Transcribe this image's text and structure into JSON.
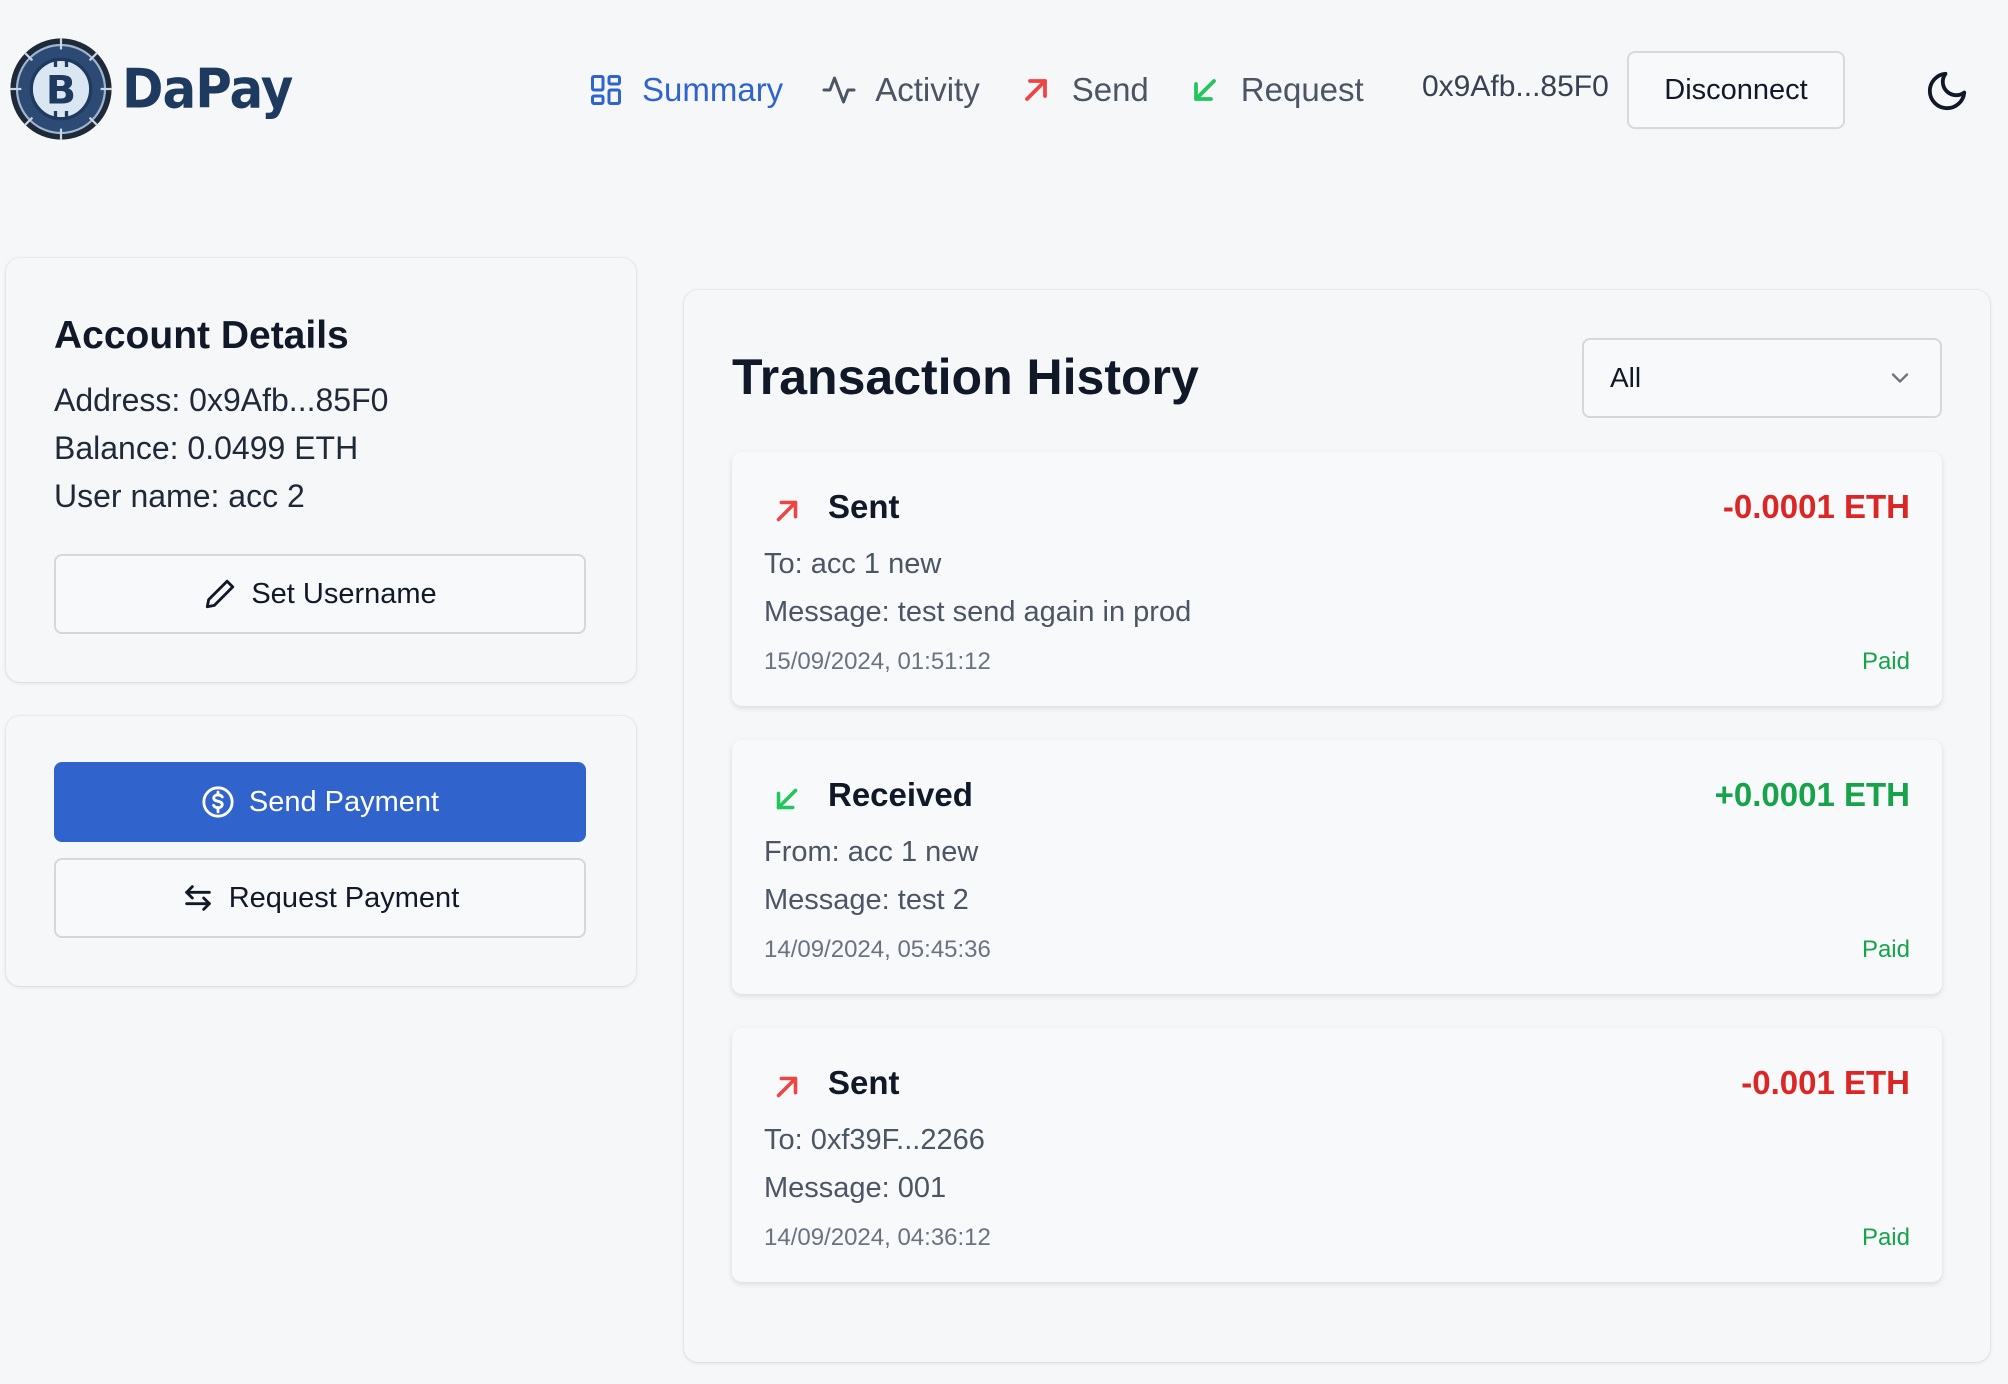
{
  "brand": {
    "name": "DaPay",
    "logo_icon": "bitcoin-gear-logo"
  },
  "colors": {
    "accent": "#3163cc",
    "sent": "#dc2626",
    "received": "#16a34a",
    "paid": "#16a34a"
  },
  "nav": {
    "items": [
      {
        "label": "Summary",
        "icon": "dashboard-icon",
        "active": true
      },
      {
        "label": "Activity",
        "icon": "activity-icon"
      },
      {
        "label": "Send",
        "icon": "arrow-up-right-icon"
      },
      {
        "label": "Request",
        "icon": "arrow-down-left-icon"
      }
    ],
    "address": "0x9Afb...85F0",
    "disconnect_label": "Disconnect",
    "theme_icon": "moon-icon"
  },
  "account": {
    "title": "Account Details",
    "address_line": "Address: 0x9Afb...85F0",
    "balance_line": "Balance: 0.0499 ETH",
    "username_line": "User name: acc 2",
    "set_username_label": "Set Username"
  },
  "payments": {
    "send_label": "Send Payment",
    "request_label": "Request Payment"
  },
  "history": {
    "title": "Transaction History",
    "filter_value": "All",
    "transactions": [
      {
        "type": "Sent",
        "amount": "-0.0001 ETH",
        "party": "To: acc 1 new",
        "message": "Message: test send again in prod",
        "date": "15/09/2024, 01:51:12",
        "status": "Paid"
      },
      {
        "type": "Received",
        "amount": "+0.0001 ETH",
        "party": "From: acc 1 new",
        "message": "Message: test 2",
        "date": "14/09/2024, 05:45:36",
        "status": "Paid"
      },
      {
        "type": "Sent",
        "amount": "-0.001 ETH",
        "party": "To: 0xf39F...2266",
        "message": "Message: 001",
        "date": "14/09/2024, 04:36:12",
        "status": "Paid"
      }
    ]
  }
}
